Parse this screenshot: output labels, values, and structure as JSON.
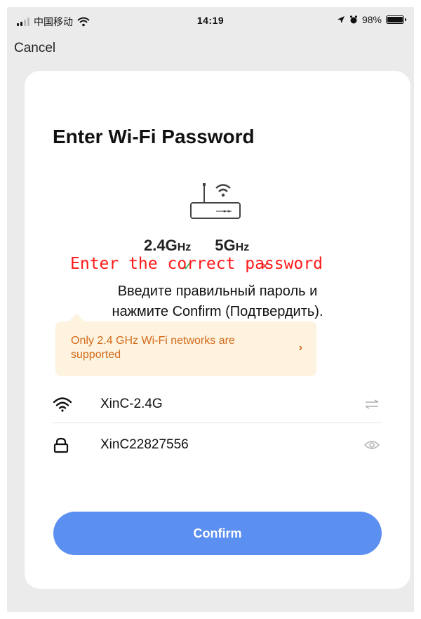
{
  "status_bar": {
    "carrier": "中国移动",
    "time": "14:19",
    "battery": "98%",
    "battery_level": 0.98
  },
  "nav": {
    "cancel_label": "Cancel"
  },
  "card": {
    "title": "Enter Wi-Fi Password",
    "bands": {
      "band_24": "2.4",
      "band_5": "5",
      "unit": "GHz",
      "check": "✓",
      "cross": "×"
    },
    "annotation_red": "Enter the correct password",
    "annotation_ru_line1": "Введите правильный пароль и",
    "annotation_ru_line2": "нажмите Confirm (Подтвердить).",
    "hint": {
      "text": "Only 2.4 GHz Wi-Fi networks are supported",
      "chevron": "›"
    },
    "ssid_value": "XinC-2.4G",
    "password_value": "XinC22827556",
    "confirm_label": "Confirm"
  },
  "colors": {
    "accent": "#5b8ff0",
    "hint_bg": "#fdf3df",
    "hint_text": "#d36a1a",
    "annotation_red": "#ff1a1a"
  },
  "icons": [
    "signal-icon",
    "wifi-status-icon",
    "location-icon",
    "battery-icon",
    "router-icon",
    "wifi-icon",
    "lock-icon",
    "switch-network-icon",
    "eye-icon"
  ]
}
